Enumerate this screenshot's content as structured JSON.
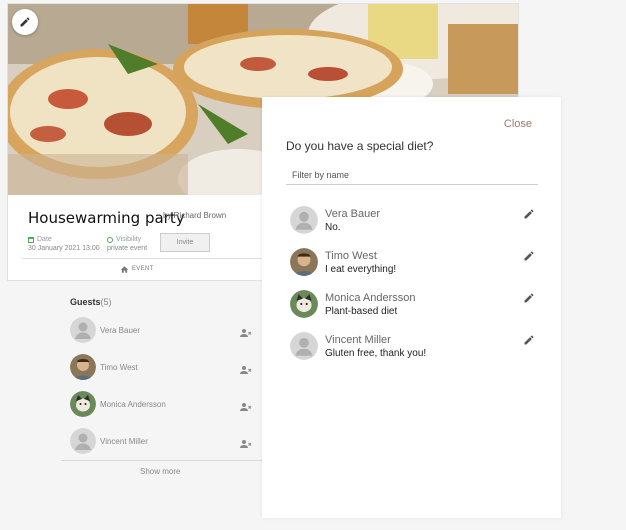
{
  "event": {
    "title": "Housewarming party",
    "by": "by Richard Brown",
    "date_label": "Date",
    "date_value": "30 January 2021 13:00",
    "visibility_label": "Visibility",
    "visibility_value": "private event",
    "invite_label": "Invite",
    "tab_label": "EVENT"
  },
  "guests": {
    "title": "Guests",
    "count": "(5)",
    "items": [
      {
        "name": "Vera Bauer",
        "avatar": "default"
      },
      {
        "name": "Timo West",
        "avatar": "photo-man"
      },
      {
        "name": "Monica Andersson",
        "avatar": "photo-cat"
      },
      {
        "name": "Vincent Miller",
        "avatar": "default"
      }
    ],
    "show_more": "Show more"
  },
  "modal": {
    "close_label": "Close",
    "question": "Do you have a special diet?",
    "filter_placeholder": "Filter by name",
    "items": [
      {
        "name": "Vera Bauer",
        "diet": "No.",
        "avatar": "default"
      },
      {
        "name": "Timo West",
        "diet": "I eat everything!",
        "avatar": "photo-man"
      },
      {
        "name": "Monica Andersson",
        "diet": "Plant-based diet",
        "avatar": "photo-cat"
      },
      {
        "name": "Vincent Miller",
        "diet": "Gluten free, thank you!",
        "avatar": "default"
      }
    ]
  },
  "colors": {
    "close_accent": "#a0766e",
    "meta_accent": "#4caf50",
    "page_bg": "#f5f5f5"
  }
}
